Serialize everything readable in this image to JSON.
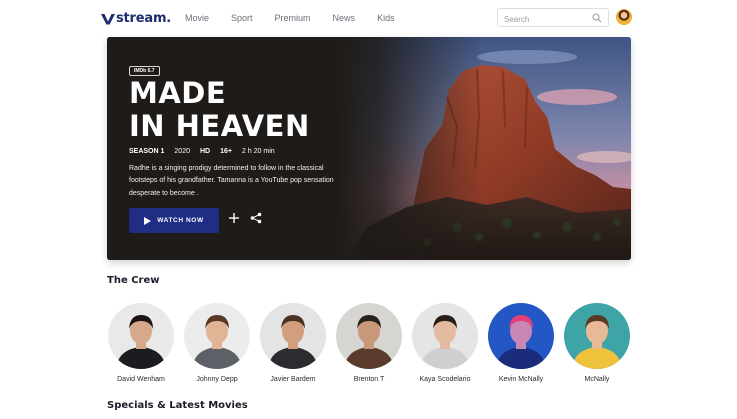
{
  "brand": {
    "name": "stream."
  },
  "nav": {
    "items": [
      "Movie",
      "Sport",
      "Premium",
      "News",
      "Kids"
    ]
  },
  "search": {
    "placeholder": "Search"
  },
  "hero": {
    "rating_badge": "IMDb 6.7",
    "title_line1": "MADE",
    "title_line2": "IN HEAVEN",
    "season": "SEASON 1",
    "year": "2020",
    "quality": "HD",
    "age": "16+",
    "duration": "2 h 20 min",
    "description": "Radhe is a singing prodigy determined to follow in the classical footsteps of his grandfather. Tamanna is a YouTube pop sensation desperate to become .",
    "watch_label": "WATCH NOW"
  },
  "crew": {
    "title": "The Crew",
    "members": [
      {
        "name": "David Wenham",
        "bg": "#e9e9ea",
        "skin": "#d7a98a",
        "hair": "#1c1512",
        "shirt": "#1b1b20"
      },
      {
        "name": "Johnny Depp",
        "bg": "#ececec",
        "skin": "#e0b596",
        "hair": "#5a3a24",
        "shirt": "#5e6068"
      },
      {
        "name": "Javier Bardem",
        "bg": "#e4e4e4",
        "skin": "#d19e7e",
        "hair": "#4a3323",
        "shirt": "#2c2c30"
      },
      {
        "name": "Brenton T",
        "bg": "#d7d5d2",
        "skin": "#c9987a",
        "hair": "#2b211c",
        "shirt": "#5a3b2c"
      },
      {
        "name": "Kaya Scodelario",
        "bg": "#e5e5e5",
        "skin": "#e4bba0",
        "hair": "#2a1e18",
        "shirt": "#cfcfd2"
      },
      {
        "name": "Kevin McNally",
        "bg": "#2457c6",
        "skin": "#c987b4",
        "hair": "#e33f78",
        "shirt": "#1b2c7a"
      },
      {
        "name": "McNally",
        "bg": "#3fa4a6",
        "skin": "#e7b996",
        "hair": "#5b3a22",
        "shirt": "#f0c13a"
      }
    ]
  },
  "specials": {
    "title": "Specials & Latest Movies"
  },
  "colors": {
    "brand": "#1f2e6e",
    "accent": "#1f2e84"
  },
  "icons": [
    "logo-v-icon",
    "search-icon",
    "play-icon",
    "plus-icon",
    "share-icon"
  ]
}
